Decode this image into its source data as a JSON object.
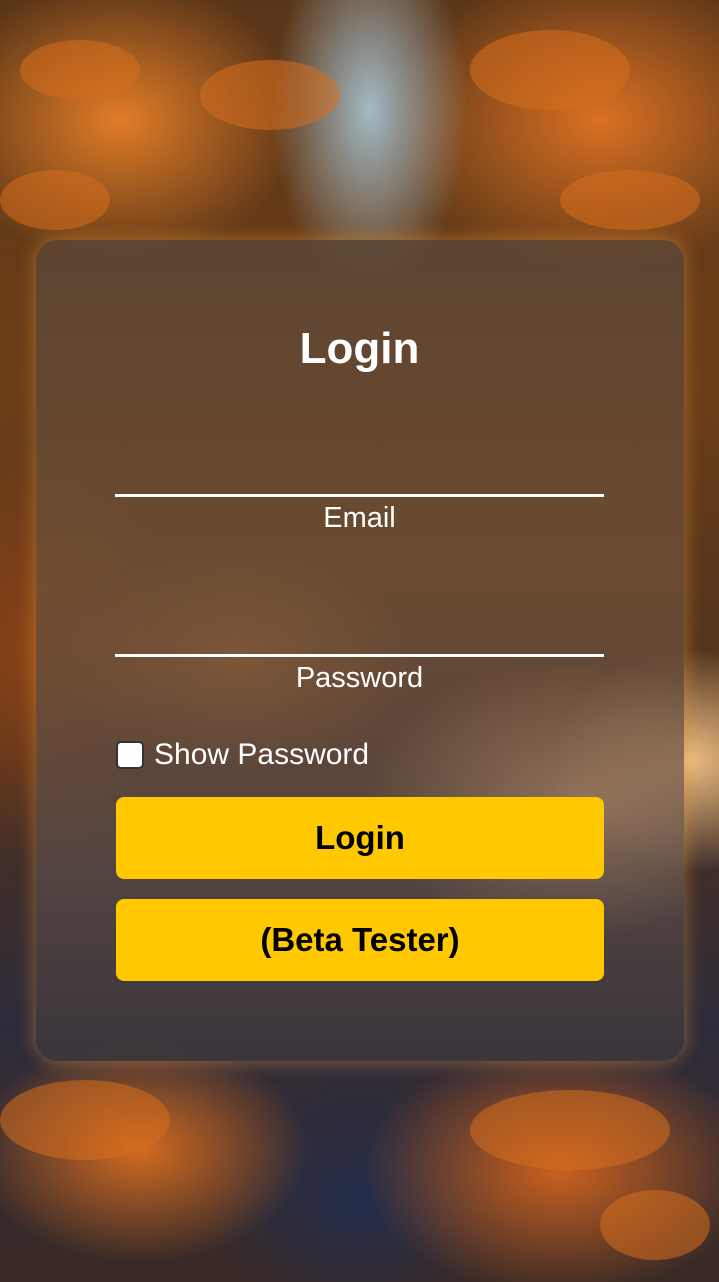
{
  "login_form": {
    "title": "Login",
    "email": {
      "label": "Email",
      "value": "",
      "placeholder": ""
    },
    "password": {
      "label": "Password",
      "value": "",
      "placeholder": ""
    },
    "show_password": {
      "label": "Show Password",
      "checked": false
    },
    "login_button_label": "Login",
    "beta_tester_button_label": "(Beta Tester)"
  },
  "colors": {
    "button_background": "#ffc800",
    "text": "#ffffff",
    "button_text": "#000000"
  }
}
